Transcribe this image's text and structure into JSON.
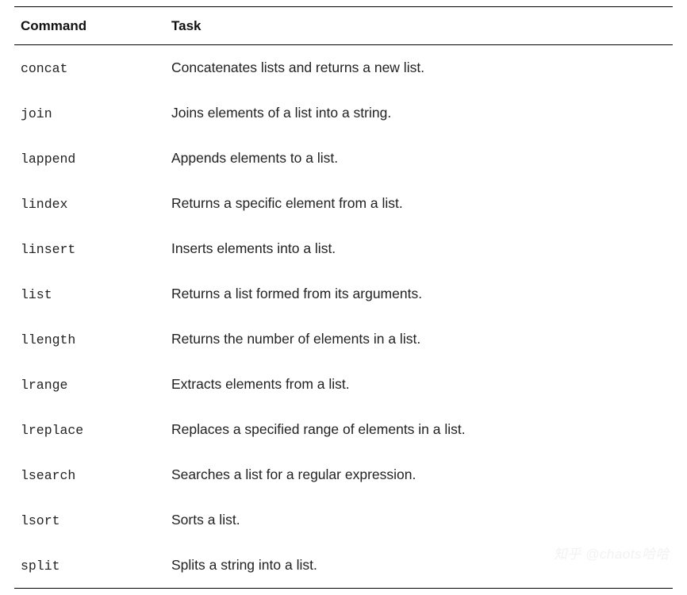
{
  "table": {
    "headers": {
      "command": "Command",
      "task": "Task"
    },
    "rows": [
      {
        "command": "concat",
        "task": "Concatenates lists and returns a new list."
      },
      {
        "command": "join",
        "task": "Joins elements of a list into a string."
      },
      {
        "command": "lappend",
        "task": "Appends elements to a list."
      },
      {
        "command": "lindex",
        "task": "Returns a specific element from a list."
      },
      {
        "command": "linsert",
        "task": "Inserts elements into a list."
      },
      {
        "command": "list",
        "task": "Returns a list formed from its arguments."
      },
      {
        "command": "llength",
        "task": "Returns the number of elements in a list."
      },
      {
        "command": "lrange",
        "task": "Extracts elements from a list."
      },
      {
        "command": "lreplace",
        "task": "Replaces a specified range of elements in a list."
      },
      {
        "command": "lsearch",
        "task": "Searches a list for a regular expression."
      },
      {
        "command": "lsort",
        "task": "Sorts a list."
      },
      {
        "command": "split",
        "task": "Splits a string into a list."
      }
    ]
  },
  "watermark": "知乎 @chaots哈哈"
}
